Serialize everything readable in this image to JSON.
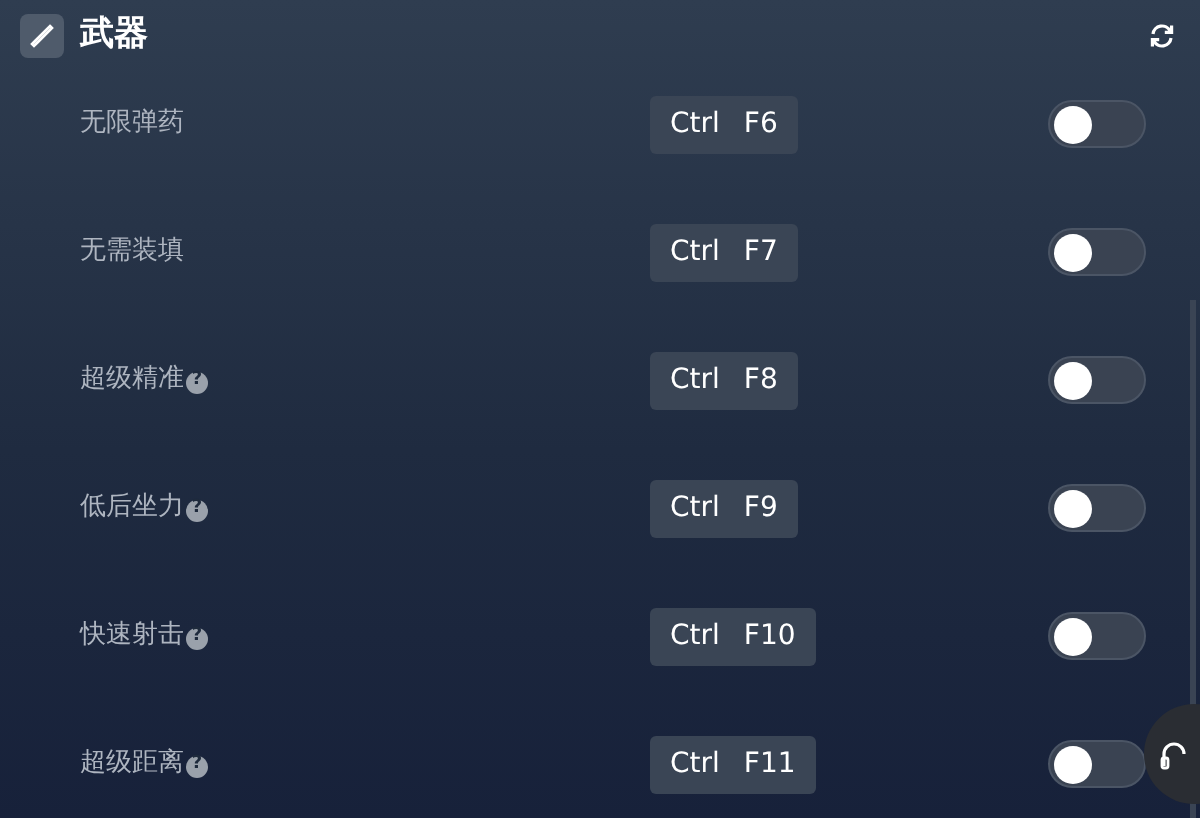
{
  "section": {
    "title": "武器"
  },
  "cheats": [
    {
      "label": "无限弹药",
      "keys": [
        "Ctrl",
        "F6"
      ],
      "on": false
    },
    {
      "label": "无需装填",
      "keys": [
        "Ctrl",
        "F7"
      ],
      "on": false
    },
    {
      "label": "超级精准",
      "hint": "?",
      "keys": [
        "Ctrl",
        "F8"
      ],
      "on": false
    },
    {
      "label": "低后坐力",
      "hint": "?",
      "keys": [
        "Ctrl",
        "F9"
      ],
      "on": false
    },
    {
      "label": "快速射击",
      "hint": "?",
      "keys": [
        "Ctrl",
        "F10"
      ],
      "on": false
    },
    {
      "label": "超级距离",
      "hint": "?",
      "keys": [
        "Ctrl",
        "F11"
      ],
      "on": false
    }
  ]
}
